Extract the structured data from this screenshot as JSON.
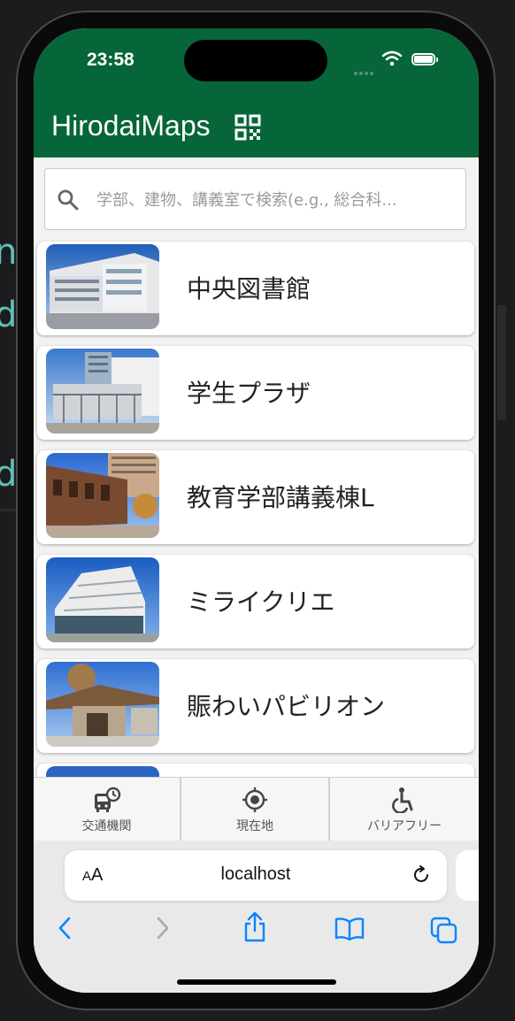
{
  "status_bar": {
    "time": "23:58"
  },
  "header": {
    "title": "HirodaiMaps",
    "qr_icon": "qr-code-icon"
  },
  "search": {
    "placeholder": "学部、建物、講義室で検索(e.g., 総合科...",
    "value": ""
  },
  "buildings": [
    {
      "name": "中央図書館",
      "photo": "library-photo"
    },
    {
      "name": "学生プラザ",
      "photo": "student-plaza-photo"
    },
    {
      "name": "教育学部講義棟L",
      "photo": "education-building-photo"
    },
    {
      "name": "ミライクリエ",
      "photo": "miraicrie-photo"
    },
    {
      "name": "賑わいパビリオン",
      "photo": "pavilion-photo"
    }
  ],
  "tabs": [
    {
      "label": "交通機関",
      "icon": "bus-clock-icon"
    },
    {
      "label": "現在地",
      "icon": "location-target-icon"
    },
    {
      "label": "バリアフリー",
      "icon": "accessibility-icon"
    }
  ],
  "browser": {
    "text_size_label_small": "A",
    "text_size_label_large": "A",
    "url": "localhost"
  },
  "colors": {
    "header": "#07653a",
    "accent": "#0a84ff"
  }
}
